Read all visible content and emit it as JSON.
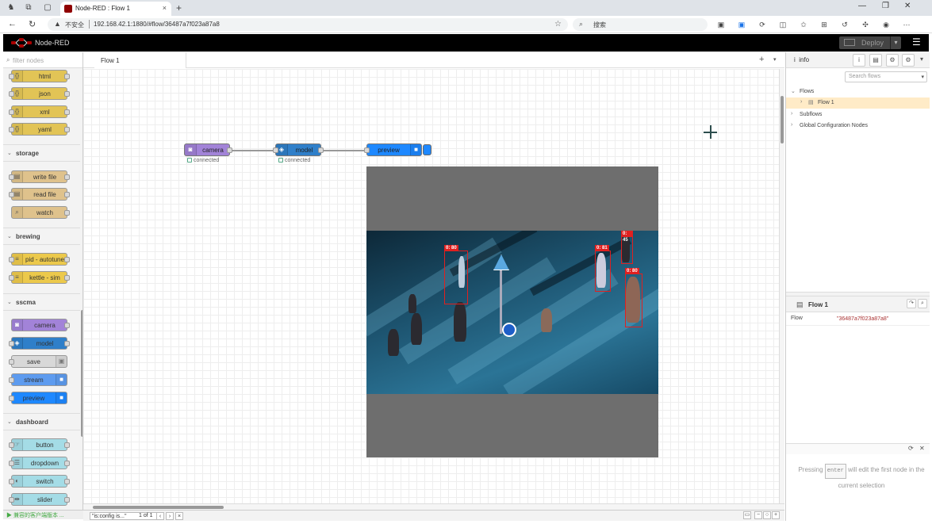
{
  "browser": {
    "tab_title": "Node-RED : Flow 1",
    "new_tab": "+",
    "tab_close": "×",
    "url_warning": "▲",
    "url_insecure": "不安全",
    "url": "192.168.42.1:1880/#flow/36487a7f023a87a8",
    "search_placeholder": "搜索",
    "min": "—",
    "max": "❐",
    "close": "✕"
  },
  "header": {
    "title": "Node-RED",
    "deploy": "Deploy",
    "deploy_caret": "▾",
    "menu": "☰"
  },
  "palette": {
    "filter_placeholder": "filter nodes",
    "categories": [
      {
        "name": "storage"
      },
      {
        "name": "brewing"
      },
      {
        "name": "sscma"
      },
      {
        "name": "dashboard"
      }
    ],
    "nodes": {
      "html": "html",
      "json": "json",
      "xml": "xml",
      "yaml": "yaml",
      "write_file": "write file",
      "read_file": "read file",
      "watch": "watch",
      "pid": "pid - autotune",
      "kettle": "kettle - sim",
      "camera": "camera",
      "model": "model",
      "save": "save",
      "stream": "stream",
      "preview": "preview",
      "button": "button",
      "dropdown": "dropdown",
      "switch": "switch",
      "slider": "slider"
    },
    "bottom_text": "▶ 兼容的客户端版本 ..."
  },
  "workspace": {
    "tab": "Flow 1",
    "add": "+",
    "menu": "▾",
    "flow_nodes": {
      "camera": "camera",
      "model": "model",
      "preview": "preview"
    },
    "status_camera": "connected",
    "status_model": "connected",
    "detections": [
      {
        "label": "0: 80"
      },
      {
        "label": "0: 81"
      },
      {
        "label": "0: 45"
      },
      {
        "label": "0: 80"
      }
    ],
    "footer": {
      "search": "\"is:config is...\"",
      "count": "1 of 1",
      "prev": "‹",
      "next": "›",
      "close": "×"
    },
    "zoom": {
      "overview": "▭",
      "minus": "−",
      "reset": "○",
      "plus": "+"
    }
  },
  "sidebar": {
    "tab_label": "info",
    "search_placeholder": "Search flows",
    "tree": {
      "flows": "Flows",
      "flow1": "Flow 1",
      "subflows": "Subflows",
      "global": "Global Configuration Nodes"
    },
    "props": {
      "title": "Flow 1",
      "key": "Flow",
      "value": "\"36487a7f023a87a8\""
    },
    "help": {
      "before": "Pressing",
      "key": "enter",
      "after": "will edit the first node in the current selection"
    }
  },
  "colors": {
    "function_yellow": "#e2c456",
    "storage_tan": "#dfc28c",
    "brewing_yellow": "#ecc94b",
    "camera_purple": "#a283d8",
    "model_blue": "#2f7fc9",
    "save_gray": "#d8d8d8",
    "stream_blue": "#5d9bef",
    "preview_blue": "#1e88ff",
    "dashboard_blue": "#a4dce6",
    "header_black": "#000000"
  }
}
